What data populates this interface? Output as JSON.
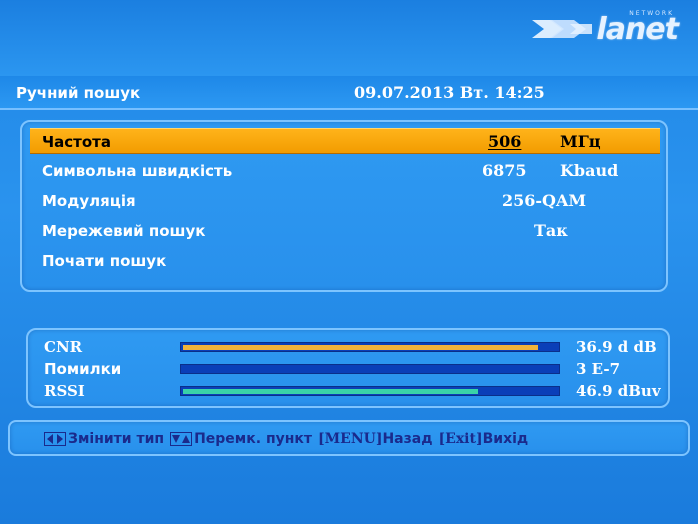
{
  "brand": {
    "logo_text": "lanet",
    "logo_sub": "NETWORK"
  },
  "header": {
    "title": "Ручний пошук",
    "datetime": "09.07.2013 Вт. 14:25"
  },
  "menu": {
    "items": [
      {
        "label": "Частота",
        "value": "506",
        "unit": "МГц",
        "selected": true
      },
      {
        "label": "Символьна швидкість",
        "value": "6875",
        "unit": "Kbaud",
        "selected": false
      },
      {
        "label": "Модуляція",
        "value": "256-QAM",
        "unit": "",
        "selected": false
      },
      {
        "label": "Мережевий пошук",
        "value": "Так",
        "unit": "",
        "selected": false
      },
      {
        "label": "Почати пошук",
        "value": "",
        "unit": "",
        "selected": false
      }
    ]
  },
  "signal": {
    "rows": [
      {
        "label": "CNR",
        "value": "36.9 d dB",
        "level": 0.95,
        "color": "#f2b33a"
      },
      {
        "label": "Помилки",
        "value": "3 E-7",
        "level": 0.0,
        "color": "#2a6ee0"
      },
      {
        "label": "RSSI",
        "value": "46.9 dBuv",
        "level": 0.79,
        "color": "#3ad2a8"
      }
    ]
  },
  "footer": {
    "change_type": "Змінити тип",
    "switch_item": "Перемк. пункт",
    "menu_key": "[MENU]",
    "back": "Назад",
    "exit_key": "[Exit]",
    "exit": "Вихід"
  },
  "colors": {
    "selected_row": "#f29c00",
    "panel_border": "#7dc4ff",
    "footer_text": "#1a2a8c"
  }
}
